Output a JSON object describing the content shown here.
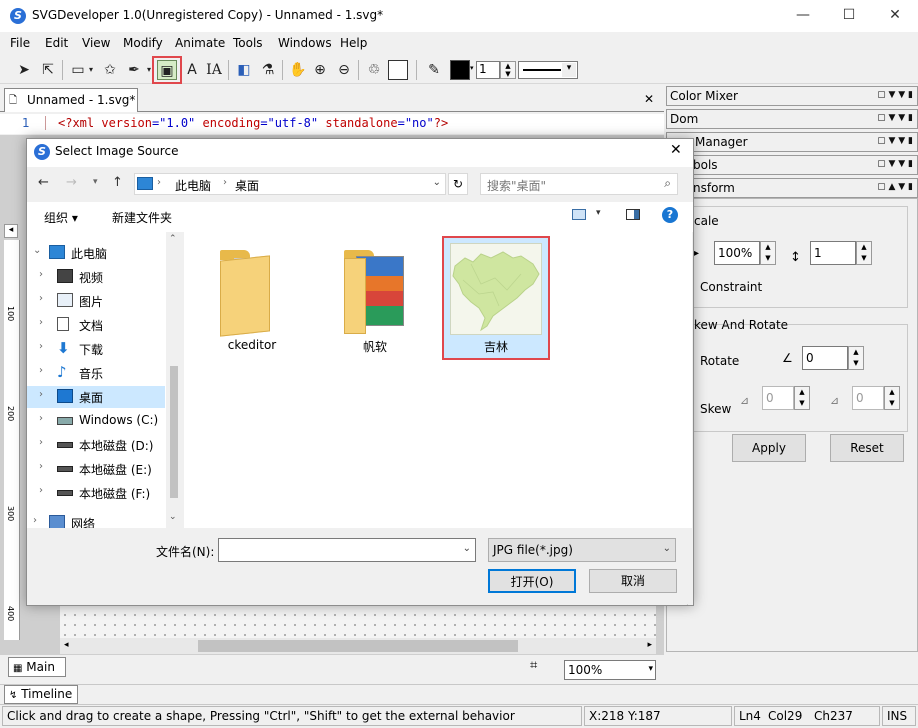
{
  "window": {
    "title": "SVGDeveloper 1.0(Unregistered Copy) - Unnamed - 1.svg*",
    "minimize": "—",
    "maximize": "☐",
    "close": "✕"
  },
  "menu": [
    "File",
    "Edit",
    "View",
    "Modify",
    "Animate",
    "Tools",
    "Windows",
    "Help"
  ],
  "toolbar": {
    "stroke_width_value": "1"
  },
  "editor": {
    "doc_tab": "Unnamed - 1.svg*",
    "line_number": "1",
    "code_parts": {
      "open": "<?xml ",
      "attr1": "version",
      "val1": "=\"1.0\"",
      "attr2": " encoding",
      "val2": "=\"utf-8\"",
      "attr3": " standalone",
      "val3": "=\"no\"",
      "close": "?>"
    },
    "ruler_marks": [
      "100",
      "200",
      "300",
      "400"
    ],
    "tab_main": "Main",
    "zoom": "100%",
    "tab_timeline": "Timeline"
  },
  "panels": {
    "color_mixer": "Color Mixer",
    "dom": "Dom",
    "manager": "Manager",
    "symbols": "bols",
    "transform": "nsform",
    "scale_section": "cale",
    "scale_x": "100%",
    "scale_y": "1",
    "constraint": "Constraint",
    "skew_rotate_section": "kew And Rotate",
    "rotate_label": "Rotate",
    "rotate_value": "0",
    "skew_label": "Skew",
    "skew_x": "0",
    "skew_y": "0",
    "apply": "Apply",
    "reset": "Reset"
  },
  "status": {
    "message": "Click and drag to create a shape, Pressing \"Ctrl\", \"Shift\" to get the external behavior",
    "coords": "X:218  Y:187",
    "line": "Ln4",
    "col": "Col29",
    "ch": "Ch237",
    "mode": "INS"
  },
  "dialog": {
    "title": "Select Image Source",
    "close": "✕",
    "breadcrumb": [
      "此电脑",
      "桌面"
    ],
    "search_placeholder": "搜索\"桌面\"",
    "organize": "组织 ▾",
    "new_folder": "新建文件夹",
    "nav_items": [
      {
        "label": "此电脑",
        "icon": "computer-icon"
      },
      {
        "label": "视频",
        "icon": "video-icon"
      },
      {
        "label": "图片",
        "icon": "pictures-icon"
      },
      {
        "label": "文档",
        "icon": "documents-icon"
      },
      {
        "label": "下载",
        "icon": "download-icon"
      },
      {
        "label": "音乐",
        "icon": "music-icon"
      },
      {
        "label": "桌面",
        "icon": "desktop-icon"
      },
      {
        "label": "Windows (C:)",
        "icon": "windows-drive-icon"
      },
      {
        "label": "本地磁盘 (D:)",
        "icon": "drive-icon"
      },
      {
        "label": "本地磁盘 (E:)",
        "icon": "drive-icon"
      },
      {
        "label": "本地磁盘 (F:)",
        "icon": "drive-icon"
      },
      {
        "label": "网络",
        "icon": "network-icon"
      }
    ],
    "files": [
      {
        "name": "ckeditor",
        "type": "folder"
      },
      {
        "name": "帆软",
        "type": "folder"
      },
      {
        "name": "吉林",
        "type": "image"
      }
    ],
    "filename_label": "文件名(N):",
    "filename_value": "",
    "filetype": "JPG file(*.jpg)",
    "open_button": "打开(O)",
    "cancel_button": "取消"
  }
}
